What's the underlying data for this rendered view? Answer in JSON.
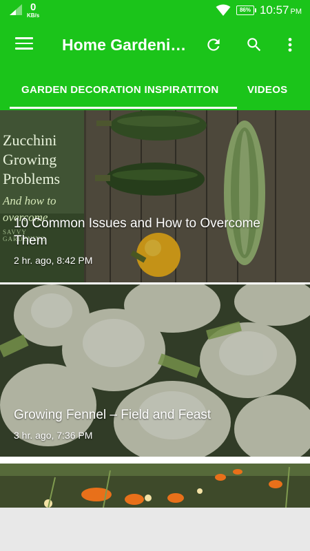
{
  "status_bar": {
    "data_rate_value": "0",
    "data_rate_unit": "KB/s",
    "battery": "86%",
    "time": "10:57",
    "ampm": "PM"
  },
  "toolbar": {
    "title": "Home Gardening Ideas",
    "icons": [
      "menu-icon",
      "refresh-icon",
      "search-icon",
      "more-vert-icon"
    ]
  },
  "tabs": [
    {
      "label": "GARDEN DECORATION INSPIRATITON",
      "active": true
    },
    {
      "label": "VIDEOS",
      "active": false
    }
  ],
  "cards": [
    {
      "title": "10 Common Issues and How to Overcome Them",
      "time": "2 hr. ago, 8:42 PM",
      "image_text": {
        "line1": "Zucchini",
        "line2": "Growing",
        "line3": "Problems",
        "line4": "And how to",
        "line5": "overcome",
        "brand1": "SAVVY",
        "brand2": "GARDENING"
      }
    },
    {
      "title": "Growing Fennel – Field and Feast",
      "time": "3 hr. ago, 7:36 PM"
    },
    {
      "title": "",
      "time": ""
    }
  ],
  "colors": {
    "primary": "#1bc41a",
    "text_on_primary": "#ffffff"
  }
}
